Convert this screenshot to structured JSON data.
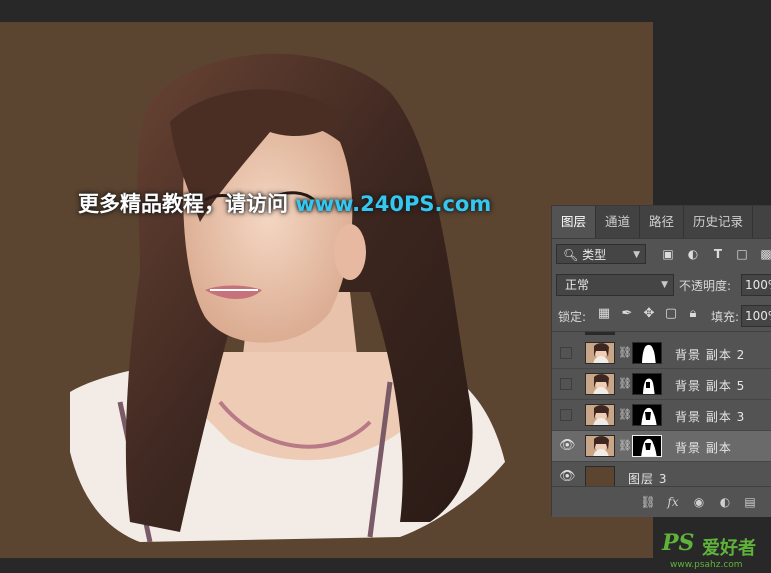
{
  "watermark": {
    "text_cn": "更多精品教程，请访问 ",
    "url": "www.240PS.com"
  },
  "layers_panel": {
    "tabs": [
      {
        "label": "图层",
        "active": true
      },
      {
        "label": "通道",
        "active": false
      },
      {
        "label": "路径",
        "active": false
      },
      {
        "label": "历史记录",
        "active": false
      }
    ],
    "filter_kind": "类型",
    "blend_mode": "正常",
    "opacity_label": "不透明度:",
    "opacity_value": "100%",
    "lock_label": "锁定:",
    "fill_label": "填充:",
    "fill_value": "100%",
    "layers": [
      {
        "name": "背景 副本 2",
        "visible": false,
        "selected": false
      },
      {
        "name": "背景 副本 5",
        "visible": false,
        "selected": false
      },
      {
        "name": "背景 副本 3",
        "visible": false,
        "selected": false
      },
      {
        "name": "背景 副本",
        "visible": true,
        "selected": true
      },
      {
        "name": "图层 3",
        "visible": true,
        "selected": false
      }
    ],
    "bottom_fx": "fx"
  },
  "site_badge": {
    "logo": "PS",
    "logo_cn": "爱好者",
    "url": "www.psahz.com"
  },
  "colors": {
    "canvas_bg": "#5b4430",
    "workspace_bg": "#282828",
    "panel_bg": "#535353",
    "url_accent": "#34c7f0",
    "badge_green": "#5fb33b"
  }
}
